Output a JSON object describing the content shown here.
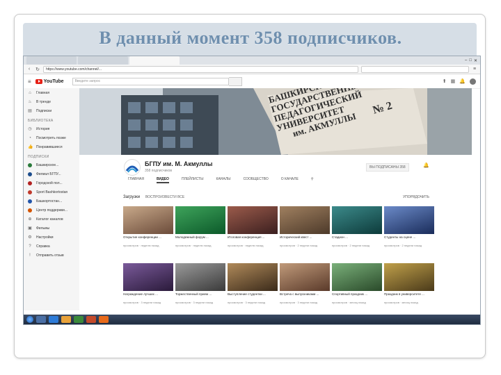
{
  "slide": {
    "title": "В данный момент 358 подписчиков."
  },
  "browser": {
    "tabs": [
      "",
      "",
      ""
    ],
    "url": "https://www.youtube.com/channel/...",
    "search_placeholder": ""
  },
  "youtube": {
    "search_placeholder": "Введите запрос"
  },
  "sidebar": {
    "items": [
      {
        "label": "Главная",
        "icon": "home-icon"
      },
      {
        "label": "В тренде",
        "icon": "fire-icon"
      },
      {
        "label": "Подписки",
        "icon": "subscriptions-icon"
      }
    ],
    "library_head": "БИБЛИОТЕКА",
    "library": [
      {
        "label": "История",
        "icon": "history-icon"
      },
      {
        "label": "Посмотреть позже",
        "icon": "clock-icon"
      },
      {
        "label": "Понравившиеся",
        "icon": "like-icon"
      }
    ],
    "subs_head": "ПОДПИСКИ",
    "subs": [
      {
        "label": "Башкирское...",
        "count": "",
        "color": "#2a7a3b"
      },
      {
        "label": "Филиал БГПУ...",
        "count": "",
        "color": "#1c4d8c"
      },
      {
        "label": "Городской пол...",
        "count": "",
        "color": "#b22222"
      },
      {
        "label": "Sport Bashkortostan",
        "count": "",
        "color": "#c0392b"
      },
      {
        "label": "Башкортостан...",
        "count": "",
        "color": "#2255aa"
      },
      {
        "label": "Центр поддержки...",
        "count": "",
        "color": "#d35400"
      }
    ],
    "more": [
      {
        "label": "Каталог каналов",
        "icon": "plus-circle-icon"
      },
      {
        "label": "Фильмы",
        "icon": "film-icon"
      },
      {
        "label": "Настройки",
        "icon": "gear-icon"
      },
      {
        "label": "Справка",
        "icon": "help-icon"
      },
      {
        "label": "Отправить отзыв",
        "icon": "feedback-icon"
      }
    ]
  },
  "banner": {
    "sign_line1": "БАШКИРСКИЙ",
    "sign_line2": "ГОСУДАРСТВЕННЫЙ",
    "sign_line3": "ПЕДАГОГИЧЕСКИЙ",
    "sign_line4": "УНИВЕРСИТЕТ",
    "sign_line5": "им. АКМУЛЛЫ",
    "corpus": "№ 2"
  },
  "channel": {
    "name": "БГПУ им. М. Акмуллы",
    "subscribers": "358 подписчиков",
    "subscribe_label": "ВЫ ПОДПИСАНЫ 358",
    "tabs": [
      "ГЛАВНАЯ",
      "ВИДЕО",
      "ПЛЕЙЛИСТЫ",
      "КАНАЛЫ",
      "СООБЩЕСТВО",
      "О КАНАЛЕ"
    ]
  },
  "uploads": {
    "heading": "Загрузки",
    "play_all": "ВОСПРОИЗВЕСТИ ВСЕ",
    "sort": "УПОРЯДОЧИТЬ"
  },
  "videos": [
    {
      "title": "Открытие конференции ...",
      "meta": "просмотров · неделю назад",
      "duration": "",
      "c1": "#6b4b3a",
      "c2": "#c8a98a"
    },
    {
      "title": "Молодежный форум ...",
      "meta": "просмотров · неделю назад",
      "duration": "",
      "c1": "#0c5a2a",
      "c2": "#3ea35b"
    },
    {
      "title": "Итоговая конференция ...",
      "meta": "просмотров · неделю назад",
      "duration": "",
      "c1": "#3b1f1f",
      "c2": "#9b5b4b"
    },
    {
      "title": "Исторический квест ...",
      "meta": "просмотров · 2 недели назад",
      "duration": "",
      "c1": "#4d3a2a",
      "c2": "#a08060"
    },
    {
      "title": "Стадион ...",
      "meta": "просмотров · 2 недели назад",
      "duration": "",
      "c1": "#0d3b3b",
      "c2": "#3c8a8a"
    },
    {
      "title": "Студенты на сцене ...",
      "meta": "просмотров · 2 недели назад",
      "duration": "",
      "c1": "#1a2c5a",
      "c2": "#6b8ac8"
    },
    {
      "title": "Награждение лучших ...",
      "meta": "просмотров · 3 недели назад",
      "duration": "",
      "c1": "#2a1a3a",
      "c2": "#7a5a9a"
    },
    {
      "title": "Торжественный прием ...",
      "meta": "просмотров · 3 недели назад",
      "duration": "",
      "c1": "#3a3a3a",
      "c2": "#9a9a9a"
    },
    {
      "title": "Выступление студентки ...",
      "meta": "просмотров · 3 недели назад",
      "duration": "",
      "c1": "#3a2a1a",
      "c2": "#b08a5a"
    },
    {
      "title": "Встреча с выпускниками ...",
      "meta": "просмотров · 3 недели назад",
      "duration": "",
      "c1": "#5a3a2a",
      "c2": "#c09a7a"
    },
    {
      "title": "Спортивный праздник ...",
      "meta": "просмотров · месяц назад",
      "duration": "",
      "c1": "#2a4a2a",
      "c2": "#7ab07a"
    },
    {
      "title": "Праздник в университете ...",
      "meta": "просмотров · месяц назад",
      "duration": "",
      "c1": "#4a3a1a",
      "c2": "#c0a04a"
    }
  ],
  "taskbar": {
    "time": "",
    "date": ""
  }
}
